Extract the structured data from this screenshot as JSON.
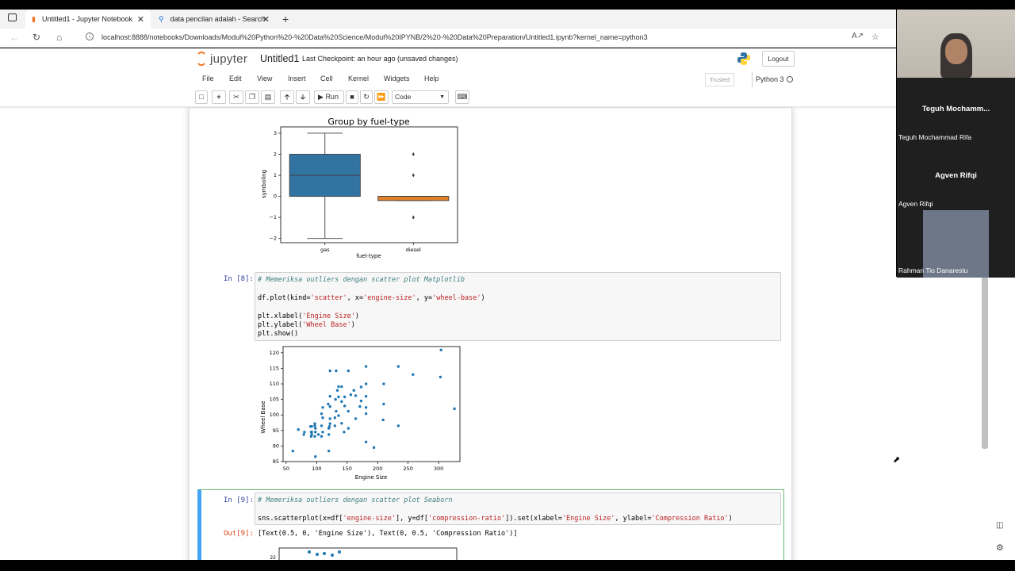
{
  "browser": {
    "tabs": [
      {
        "label": "Untitled1 - Jupyter Notebook",
        "active": true
      },
      {
        "label": "data pencilan adalah - Search",
        "active": false
      }
    ],
    "url": "localhost:8888/notebooks/Downloads/Modul%20Python%20-%20Data%20Science/Modul%20IPYNB/2%20-%20Data%20Preparation/Untitled1.ipynb?kernel_name=python3"
  },
  "jupyter": {
    "logo_text": "jupyter",
    "notebook_name": "Untitled1",
    "checkpoint": "Last Checkpoint: an hour ago",
    "unsaved": "(unsaved changes)",
    "logout_label": "Logout",
    "menu": [
      "File",
      "Edit",
      "View",
      "Insert",
      "Cell",
      "Kernel",
      "Widgets",
      "Help"
    ],
    "trusted": "Trusted",
    "kernel": "Python 3",
    "run_label": "Run",
    "cell_type": "Code"
  },
  "cells": {
    "cell8": {
      "prompt": "In [8]:",
      "lines": [
        "# Memeriksa outliers dengan scatter plot Matplotlib",
        "",
        "df.plot(kind='scatter', x='engine-size', y='wheel-base')",
        "",
        "plt.xlabel('Engine Size')",
        "plt.ylabel('Wheel Base')",
        "plt.show()"
      ]
    },
    "cell9": {
      "prompt": "In [9]:",
      "out_prompt": "Out[9]:",
      "lines": [
        "# Memeriksa outliers dengan scatter plot Seaborn",
        "",
        "sns.scatterplot(x=df['engine-size'], y=df['compression-ratio']).set(xlabel='Engine Size', ylabel='Compression Ratio')"
      ],
      "output": "[Text(0.5, 0, 'Engine Size'), Text(0, 0.5, 'Compression Ratio')]"
    }
  },
  "chart_data": [
    {
      "type": "box",
      "title": "Group by fuel-type",
      "xlabel": "fuel-type",
      "ylabel": "symboling",
      "categories": [
        "gas",
        "diesel"
      ],
      "ylim": [
        -2.2,
        3.3
      ],
      "yticks": [
        -2,
        -1,
        0,
        1,
        2,
        3
      ],
      "ytick_labels": [
        "−2",
        "−1",
        "0",
        "1",
        "2",
        "3"
      ],
      "boxes": [
        {
          "category": "gas",
          "whisker_low": -2,
          "q1": 0,
          "median": 1,
          "q3": 2,
          "whisker_high": 3,
          "outliers": [],
          "color": "#3274a1"
        },
        {
          "category": "diesel",
          "whisker_low": -0.2,
          "q1": -0.2,
          "median": 0,
          "q3": 0,
          "whisker_high": 0,
          "outliers": [
            2,
            1,
            -1
          ],
          "color": "#e1812c"
        }
      ]
    },
    {
      "type": "scatter",
      "xlabel": "Engine Size",
      "ylabel": "Wheel Base",
      "xlim": [
        45,
        335
      ],
      "ylim": [
        85,
        122
      ],
      "xticks": [
        50,
        100,
        150,
        200,
        250,
        300
      ],
      "yticks": [
        85,
        90,
        95,
        100,
        105,
        110,
        115,
        120
      ],
      "color": "#1f77b4",
      "points": [
        [
          304,
          120.9
        ],
        [
          303,
          112.2
        ],
        [
          326,
          102
        ],
        [
          258,
          113
        ],
        [
          234,
          115.6
        ],
        [
          210,
          110
        ],
        [
          210,
          103.5
        ],
        [
          234,
          96.5
        ],
        [
          209,
          98.4
        ],
        [
          181,
          115.6
        ],
        [
          181,
          110
        ],
        [
          173,
          109
        ],
        [
          181,
          106
        ],
        [
          181,
          102.4
        ],
        [
          181,
          100.4
        ],
        [
          181,
          91.3
        ],
        [
          194,
          89.5
        ],
        [
          164,
          106.2
        ],
        [
          173,
          104.5
        ],
        [
          171,
          102.7
        ],
        [
          161,
          107.9
        ],
        [
          156,
          106.5
        ],
        [
          152,
          101.2
        ],
        [
          146,
          105.8
        ],
        [
          146,
          102.9
        ],
        [
          141,
          109.1
        ],
        [
          141,
          104.3
        ],
        [
          141,
          97.3
        ],
        [
          145,
          94.5
        ],
        [
          152,
          95.7
        ],
        [
          136,
          109.1
        ],
        [
          136,
          105.8
        ],
        [
          136,
          99.8
        ],
        [
          134,
          107.9
        ],
        [
          132,
          101.2
        ],
        [
          131,
          105
        ],
        [
          130,
          99.1
        ],
        [
          130,
          96.5
        ],
        [
          122,
          114.2
        ],
        [
          122,
          106
        ],
        [
          122,
          102.7
        ],
        [
          122,
          98.8
        ],
        [
          122,
          97.2
        ],
        [
          121,
          96.3
        ],
        [
          120,
          93.7
        ],
        [
          119,
          103.5
        ],
        [
          110,
          102.4
        ],
        [
          110,
          99.1
        ],
        [
          108,
          96.5
        ],
        [
          110,
          94.5
        ],
        [
          108,
          93.1
        ],
        [
          103,
          93.7
        ],
        [
          98,
          94.5
        ],
        [
          98,
          95.7
        ],
        [
          97,
          93.1
        ],
        [
          97,
          96.5
        ],
        [
          97,
          97.2
        ],
        [
          98,
          86.6
        ],
        [
          92,
          94.5
        ],
        [
          92,
          93.7
        ],
        [
          92,
          96.3
        ],
        [
          91,
          94.5
        ],
        [
          91,
          93.1
        ],
        [
          90,
          96.3
        ],
        [
          79,
          93.7
        ],
        [
          70,
          95.3
        ],
        [
          61,
          88.4
        ],
        [
          80,
          94.5
        ],
        [
          108,
          100.4
        ],
        [
          120,
          95.7
        ],
        [
          132,
          114.2
        ],
        [
          152,
          114.2
        ],
        [
          120,
          88.4
        ],
        [
          164,
          98.8
        ]
      ]
    },
    {
      "type": "scatter",
      "xlabel": "Engine Size",
      "ylabel": "Compression Ratio",
      "ytick_visible": "22",
      "color": "#1f77b4",
      "note_partial": "partially visible"
    }
  ],
  "video": {
    "p1_title": "Teguh Mochamm...",
    "p1_name": "Teguh Mochammad Rifa",
    "p2_title": "Agven Rifqi",
    "p2_name": "Agven Rifqi",
    "p3_name": "Rahman Tio Danarestu"
  }
}
